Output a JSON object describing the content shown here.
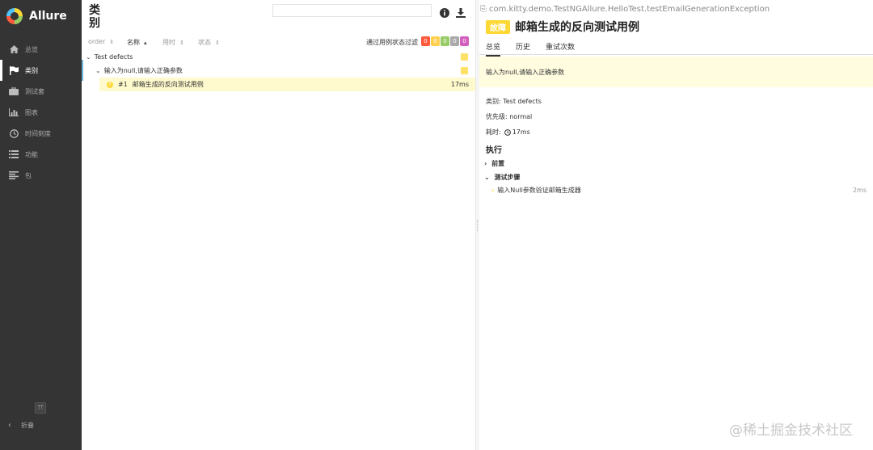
{
  "app": {
    "name": "Allure"
  },
  "sidebar": {
    "items": [
      {
        "label": "总览",
        "icon": "home-icon"
      },
      {
        "label": "类别",
        "icon": "flag-icon",
        "active": true
      },
      {
        "label": "测试套",
        "icon": "briefcase-icon"
      },
      {
        "label": "图表",
        "icon": "bar-chart-icon"
      },
      {
        "label": "时间刻度",
        "icon": "clock-icon"
      },
      {
        "label": "功能",
        "icon": "list-icon"
      },
      {
        "label": "包",
        "icon": "align-left-icon"
      }
    ],
    "collapse_label": "折叠",
    "collapse_chevron": "‹"
  },
  "categories": {
    "title": "类别",
    "search_placeholder": "",
    "sort": {
      "order": "order",
      "name": "名称",
      "duration": "用时",
      "status": "状态"
    },
    "filter_label": "通过用例状态过滤",
    "badges": [
      {
        "count": "0",
        "color": "#fd5a3e"
      },
      {
        "count": "0",
        "color": "#ffd050"
      },
      {
        "count": "0",
        "color": "#97cc64"
      },
      {
        "count": "0",
        "color": "#aaaaaa"
      },
      {
        "count": "0",
        "color": "#d35ebe"
      }
    ],
    "tree": {
      "group": "Test defects",
      "subgroup": "输入为null,请输入正确参数",
      "leaf": {
        "num": "#1",
        "name": "邮箱生成的反向测试用例",
        "time": "17ms"
      }
    }
  },
  "detail": {
    "fullname": "com.kitty.demo.TestNGAllure.HelloTest.testEmailGenerationException",
    "status": "故障",
    "status_color": "#fdd835",
    "title": "邮箱生成的反向测试用例",
    "tabs": [
      "总览",
      "历史",
      "重试次数"
    ],
    "message": "输入为null,请输入正确参数",
    "category": "类别: Test defects",
    "severity": "优先级: normal",
    "duration_label": "耗时:",
    "duration": "17ms",
    "execution": "执行",
    "setup": "前置",
    "steps": "测试步骤",
    "step": {
      "name": "输入Null参数验证邮箱生成器",
      "time": "2ms"
    }
  },
  "watermark": "@稀土掘金技术社区"
}
